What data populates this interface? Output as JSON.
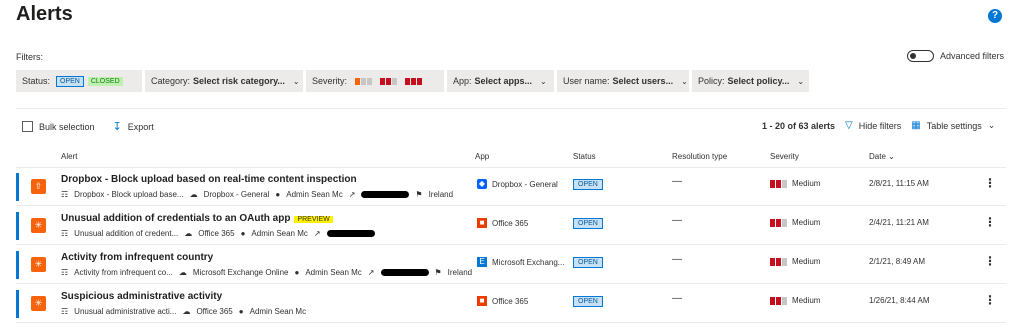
{
  "page": {
    "title": "Alerts",
    "help": "?"
  },
  "filters": {
    "label": "Filters:",
    "advanced": "Advanced filters",
    "status_label": "Status:",
    "status_open": "OPEN",
    "status_closed": "CLOSED",
    "category_label": "Category:",
    "category_value": "Select risk category...",
    "severity_label": "Severity:",
    "app_label": "App:",
    "app_value": "Select apps...",
    "user_label": "User name:",
    "user_value": "Select users...",
    "policy_label": "Policy:",
    "policy_value": "Select policy..."
  },
  "toolbar": {
    "bulk": "Bulk selection",
    "export": "Export",
    "count": "1 - 20 of 63 alerts",
    "hide_filters": "Hide filters",
    "table_settings": "Table settings"
  },
  "columns": {
    "alert": "Alert",
    "app": "App",
    "status": "Status",
    "resolution": "Resolution type",
    "severity": "Severity",
    "date": "Date"
  },
  "rows": [
    {
      "title": "Dropbox - Block upload based on real-time content inspection",
      "policy": "Dropbox - Block upload base...",
      "app_meta": "Dropbox - General",
      "user": "Admin Sean Mc",
      "location": "Ireland",
      "app": "Dropbox - General",
      "status": "OPEN",
      "resolution": "—",
      "severity": "Medium",
      "date": "2/8/21, 11:15 AM"
    },
    {
      "title": "Unusual addition of credentials to an OAuth app",
      "preview": "PREVIEW",
      "policy": "Unusual addition of credent...",
      "app_meta": "Office 365",
      "user": "Admin Sean Mc",
      "app": "Office 365",
      "status": "OPEN",
      "resolution": "—",
      "severity": "Medium",
      "date": "2/4/21, 11:21 AM"
    },
    {
      "title": "Activity from infrequent country",
      "policy": "Activity from infrequent co...",
      "app_meta": "Microsoft Exchange Online",
      "user": "Admin Sean Mc",
      "location": "Ireland",
      "app": "Microsoft Exchang...",
      "status": "OPEN",
      "resolution": "—",
      "severity": "Medium",
      "date": "2/1/21, 8:49 AM"
    },
    {
      "title": "Suspicious administrative activity",
      "policy": "Unusual administrative acti...",
      "app_meta": "Office 365",
      "user": "Admin Sean Mc",
      "app": "Office 365",
      "status": "OPEN",
      "resolution": "—",
      "severity": "Medium",
      "date": "1/26/21, 8:44 AM"
    }
  ],
  "colors": {
    "accent": "#0078d4",
    "alert_icon": "#f7630c",
    "severity_on": "#c50f1f"
  }
}
